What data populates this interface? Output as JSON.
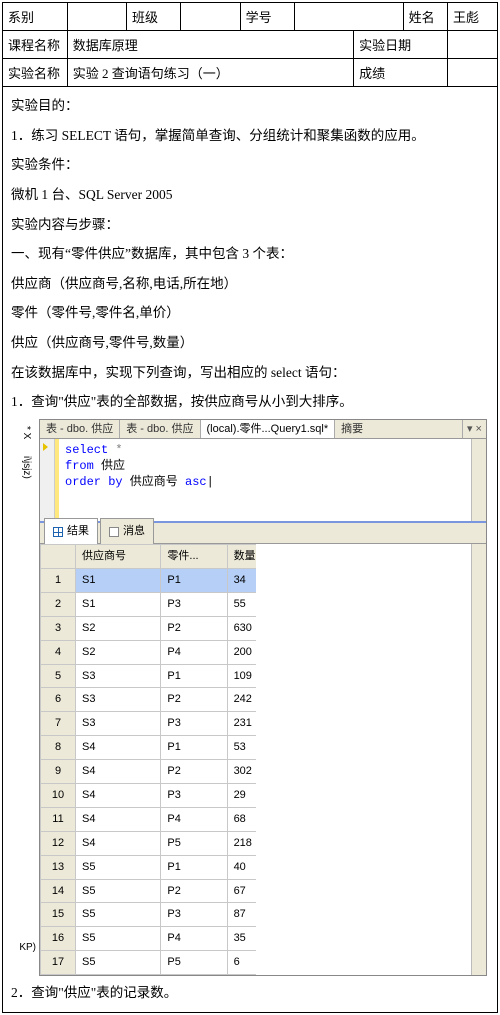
{
  "header": {
    "dept_label": "系别",
    "dept_value": "",
    "class_label": "班级",
    "class_value": "",
    "sid_label": "学号",
    "sid_value": "",
    "name_label": "姓名",
    "name_value": "王彪",
    "course_label": "课程名称",
    "course_value": "数据库原理",
    "date_label": "实验日期",
    "date_value": "",
    "exp_label": "实验名称",
    "exp_value": "实验 2  查询语句练习（一）",
    "score_label": "成绩",
    "score_value": ""
  },
  "body": {
    "purpose_title": "实验目的：",
    "purpose_1": "1．练习 SELECT 语句，掌握简单查询、分组统计和聚集函数的应用。",
    "cond_title": "实验条件：",
    "cond_1": "微机 1 台、SQL Server 2005",
    "steps_title": "实验内容与步骤：",
    "step_intro": "一、现有“零件供应”数据库，其中包含 3 个表：",
    "tbl1": "供应商（供应商号,名称,电话,所在地）",
    "tbl2": "零件（零件号,零件名,单价）",
    "tbl3": "供应（供应商号,零件号,数量）",
    "task": "在该数据库中，实现下列查询，写出相应的 select 语句：",
    "q1": "1．查询\"供应\"表的全部数据，按供应商号从小到大排序。",
    "q2": "2．查询\"供应\"表的记录数。"
  },
  "ssms": {
    "tabs": {
      "t1": "表 - dbo. 供应",
      "t2": "表 - dbo. 供应",
      "t3": "(local).零件...Query1.sql*",
      "t4": "摘要"
    },
    "sql": {
      "l1a": "select",
      "l1b": " *",
      "l2a": "from",
      "l2b": " 供应",
      "l3a": "order by",
      "l3b": " 供应商号 ",
      "l3c": "asc"
    },
    "rtabs": {
      "results": "结果",
      "messages": "消息"
    },
    "cols": {
      "c1": "供应商号",
      "c2": "零件...",
      "c3": "数量"
    },
    "rows": [
      {
        "n": "1",
        "a": "S1",
        "b": "P1",
        "c": "34"
      },
      {
        "n": "2",
        "a": "S1",
        "b": "P3",
        "c": "55"
      },
      {
        "n": "3",
        "a": "S2",
        "b": "P2",
        "c": "630"
      },
      {
        "n": "4",
        "a": "S2",
        "b": "P4",
        "c": "200"
      },
      {
        "n": "5",
        "a": "S3",
        "b": "P1",
        "c": "109"
      },
      {
        "n": "6",
        "a": "S3",
        "b": "P2",
        "c": "242"
      },
      {
        "n": "7",
        "a": "S3",
        "b": "P3",
        "c": "231"
      },
      {
        "n": "8",
        "a": "S4",
        "b": "P1",
        "c": "53"
      },
      {
        "n": "9",
        "a": "S4",
        "b": "P2",
        "c": "302"
      },
      {
        "n": "10",
        "a": "S4",
        "b": "P3",
        "c": "29"
      },
      {
        "n": "11",
        "a": "S4",
        "b": "P4",
        "c": "68"
      },
      {
        "n": "12",
        "a": "S4",
        "b": "P5",
        "c": "218"
      },
      {
        "n": "13",
        "a": "S5",
        "b": "P1",
        "c": "40"
      },
      {
        "n": "14",
        "a": "S5",
        "b": "P2",
        "c": "67"
      },
      {
        "n": "15",
        "a": "S5",
        "b": "P3",
        "c": "87"
      },
      {
        "n": "16",
        "a": "S5",
        "b": "P4",
        "c": "35"
      },
      {
        "n": "17",
        "a": "S5",
        "b": "P5",
        "c": "6"
      }
    ],
    "sidebar": {
      "top": "* X",
      "tree": "i\\jsjz)",
      "kp": "KP)"
    }
  }
}
